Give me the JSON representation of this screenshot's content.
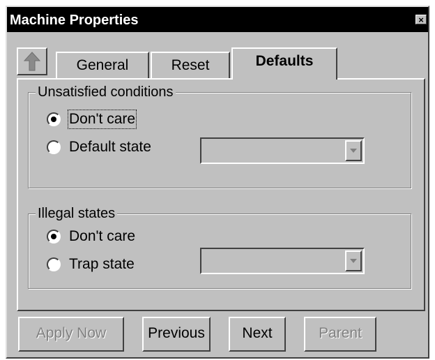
{
  "window": {
    "title": "Machine Properties"
  },
  "tabs": [
    {
      "label": "General",
      "active": false
    },
    {
      "label": "Reset",
      "active": false
    },
    {
      "label": "Defaults",
      "active": true
    }
  ],
  "unsatisfied": {
    "legend": "Unsatisfied conditions",
    "option_dont_care": "Don't care",
    "option_default_state": "Default state",
    "selected": "Don't care",
    "dropdown_value": ""
  },
  "illegal": {
    "legend": "Illegal states",
    "option_dont_care": "Don't care",
    "option_trap_state": "Trap state",
    "selected": "Don't care",
    "dropdown_value": ""
  },
  "buttons": {
    "apply_now": "Apply Now",
    "previous": "Previous",
    "next": "Next",
    "parent": "Parent"
  },
  "icons": {
    "close": "close-icon",
    "up": "up-arrow-icon"
  },
  "colors": {
    "face": "#c0c0c0",
    "titlebar": "#000000",
    "disabled_text": "#808080"
  }
}
